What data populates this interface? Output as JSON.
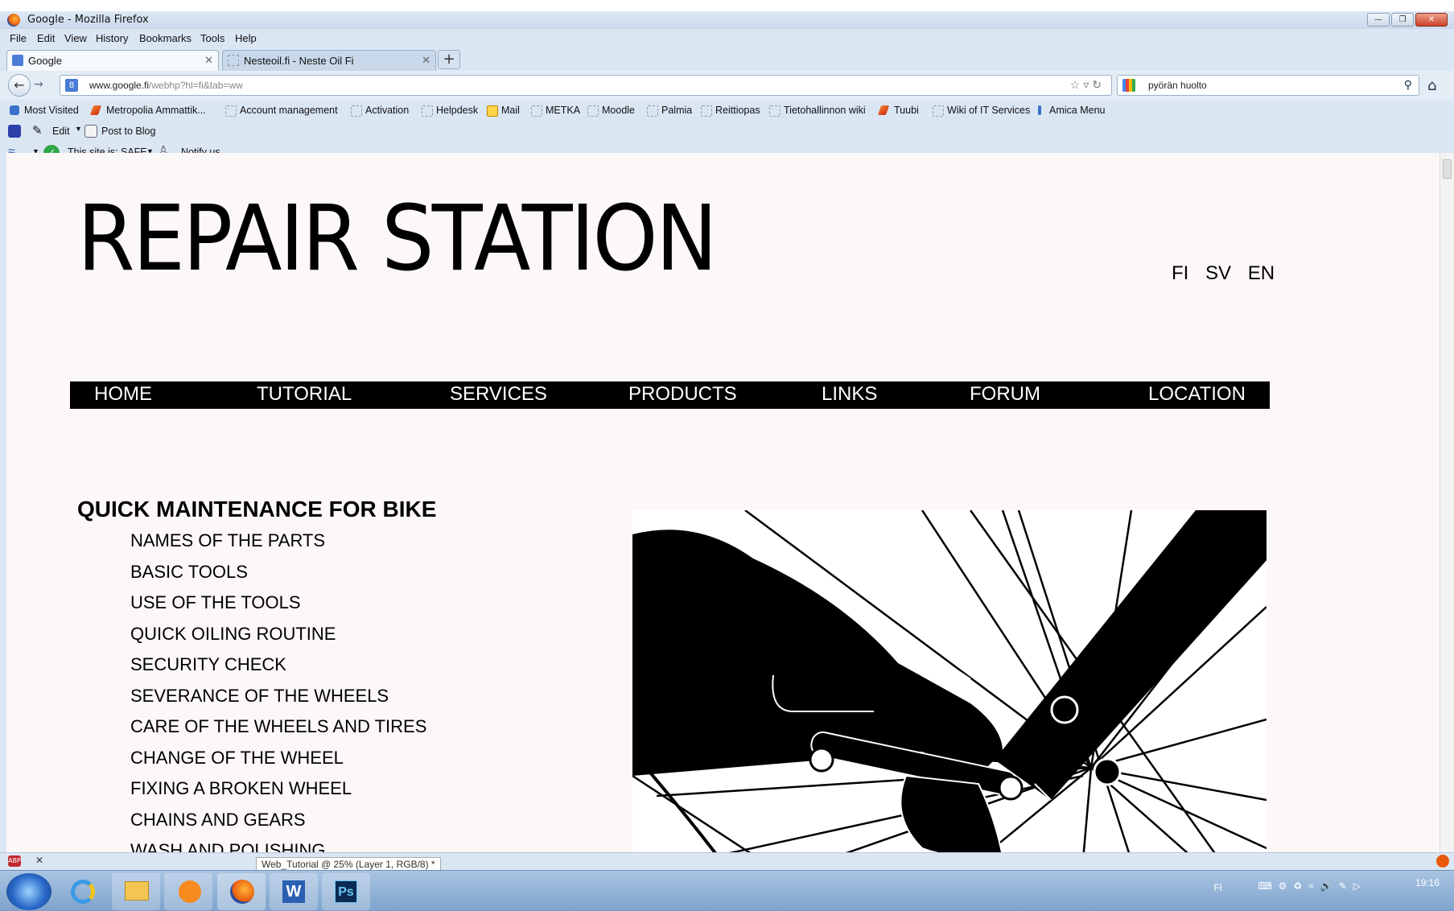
{
  "window": {
    "title": "Google - Mozilla Firefox"
  },
  "menubar": [
    "File",
    "Edit",
    "View",
    "History",
    "Bookmarks",
    "Tools",
    "Help"
  ],
  "tabs": [
    {
      "label": "Google",
      "active": true
    },
    {
      "label": "Nesteoil.fi - Neste Oil Fi",
      "active": false
    }
  ],
  "navbar": {
    "url_domain": "www.google.fi",
    "url_path": "/webhp?hl=fi&tab=ww",
    "search_value": "pyörän huolto"
  },
  "bookmarks": [
    "Most Visited",
    "Metropolia Ammattik...",
    "Account management",
    "Activation",
    "Helpdesk",
    "Mail",
    "METKA",
    "Moodle",
    "Palmia",
    "Reittiopas",
    "Tietohallinnon wiki",
    "Tuubi",
    "Wiki of IT Services",
    "Amica Menu"
  ],
  "toolbar1": {
    "edit": "Edit",
    "post": "Post to Blog"
  },
  "toolbar2": {
    "safe": "This site is: SAFE",
    "notify": "Notify us"
  },
  "site": {
    "title": "REPAIR STATION",
    "languages": [
      "FI",
      "SV",
      "EN"
    ],
    "nav": [
      "HOME",
      "TUTORIAL",
      "SERVICES",
      "PRODUCTS",
      "LINKS",
      "FORUM",
      "LOCATION"
    ],
    "section_title": "QUICK MAINTENANCE FOR BIKE",
    "topics": [
      "NAMES OF THE PARTS",
      "BASIC TOOLS",
      "USE OF THE TOOLS",
      "QUICK OILING ROUTINE",
      "SECURITY CHECK",
      "SEVERANCE OF THE WHEELS",
      "CARE OF THE WHEELS AND TIRES",
      "CHANGE OF THE WHEEL",
      "FIXING A BROKEN WHEEL",
      "CHAINS AND GEARS",
      "WASH AND POLISHING"
    ]
  },
  "taskbar": {
    "photoshop_tooltip": "Web_Tutorial @ 25% (Layer 1, RGB/8) *",
    "lang": "FI",
    "time": "19:16"
  },
  "icons": [
    "firefox-icon",
    "google-favicon",
    "back-arrow-icon",
    "forward-arrow-icon",
    "bookmark-star-icon",
    "reload-icon",
    "search-icon",
    "home-icon",
    "windows-start-icon"
  ]
}
